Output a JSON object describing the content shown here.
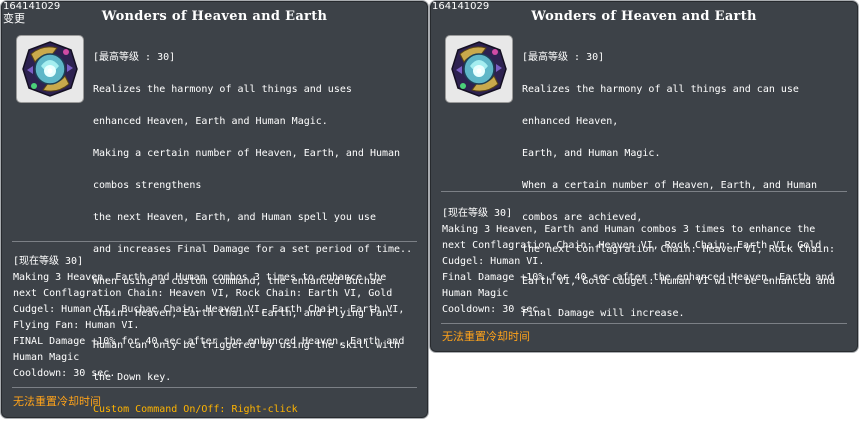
{
  "left": {
    "skill_id": "164141029",
    "change_label": "变更",
    "title": "Wonders of Heaven and Earth",
    "icon": "heaven-earth-skill-icon",
    "description_lines": [
      "[最高等级 : 30]",
      "Realizes the harmony of all things and uses",
      "enhanced Heaven, Earth and Human Magic.",
      "Making a certain number of Heaven, Earth, and Human",
      "combos strengthens",
      "the next Heaven, Earth, and Human spell you use",
      "and increases Final Damage for a set period of time..",
      "When using a custom command, the enhanced Buchae",
      "Chain: Heaven, Earth Chain: Earth, and Flying Fan:",
      "Human can only be triggered by using the skill with",
      "the Down key."
    ],
    "custom_command": "Custom Command On/Off: Right-click",
    "current_lines": [
      "[现在等级 30]",
      "Making 3 Heaven, Earth and Human combos 3 times to enhance the",
      "next Conflagration Chain: Heaven VI, Rock Chain: Earth VI, Gold",
      "Cudgel: Human VI, Buchae Chain: Heaven VI, Earth Chain: Earth VI,",
      "Flying Fan: Human VI.",
      "FINAL Damage +10% for 40 sec after the enhanced Heaven, Earth and",
      "Human Magic",
      "Cooldown: 30 sec."
    ],
    "cooldown_note": "无法重置冷却时间"
  },
  "right": {
    "skill_id": "164141029",
    "title": "Wonders of Heaven and Earth",
    "icon": "heaven-earth-skill-icon",
    "description_lines": [
      "[最高等级 : 30]",
      "Realizes the harmony of all things and can use",
      "enhanced Heaven,",
      "Earth, and Human Magic.",
      "When a certain number of Heaven, Earth, and Human",
      "combos are achieved,",
      "the next Conflagration Chain: Heaven VI, Rock Chain:",
      "Earth VI, Gold Cudgel: Human VI will be enhanced and",
      "Final Damage will increase."
    ],
    "current_lines": [
      "[现在等级 30]",
      "Making 3 Heaven, Earth and Human combos 3 times to enhance the",
      "next Conflagration Chain: Heaven VI, Rock Chain: Earth VI, Gold",
      "Cudgel: Human VI.",
      "Final Damage +10% for 40 sec after the enhanced Heaven, Earth and",
      "Human Magic",
      "Cooldown: 30 sec."
    ],
    "cooldown_note": "无法重置冷却时间"
  },
  "colors": {
    "panel_bg": "#3d4248",
    "panel_border": "#a9acb0",
    "text": "#ffffff",
    "highlight": "#ffb400",
    "cooldown_note": "#ffa31a"
  }
}
